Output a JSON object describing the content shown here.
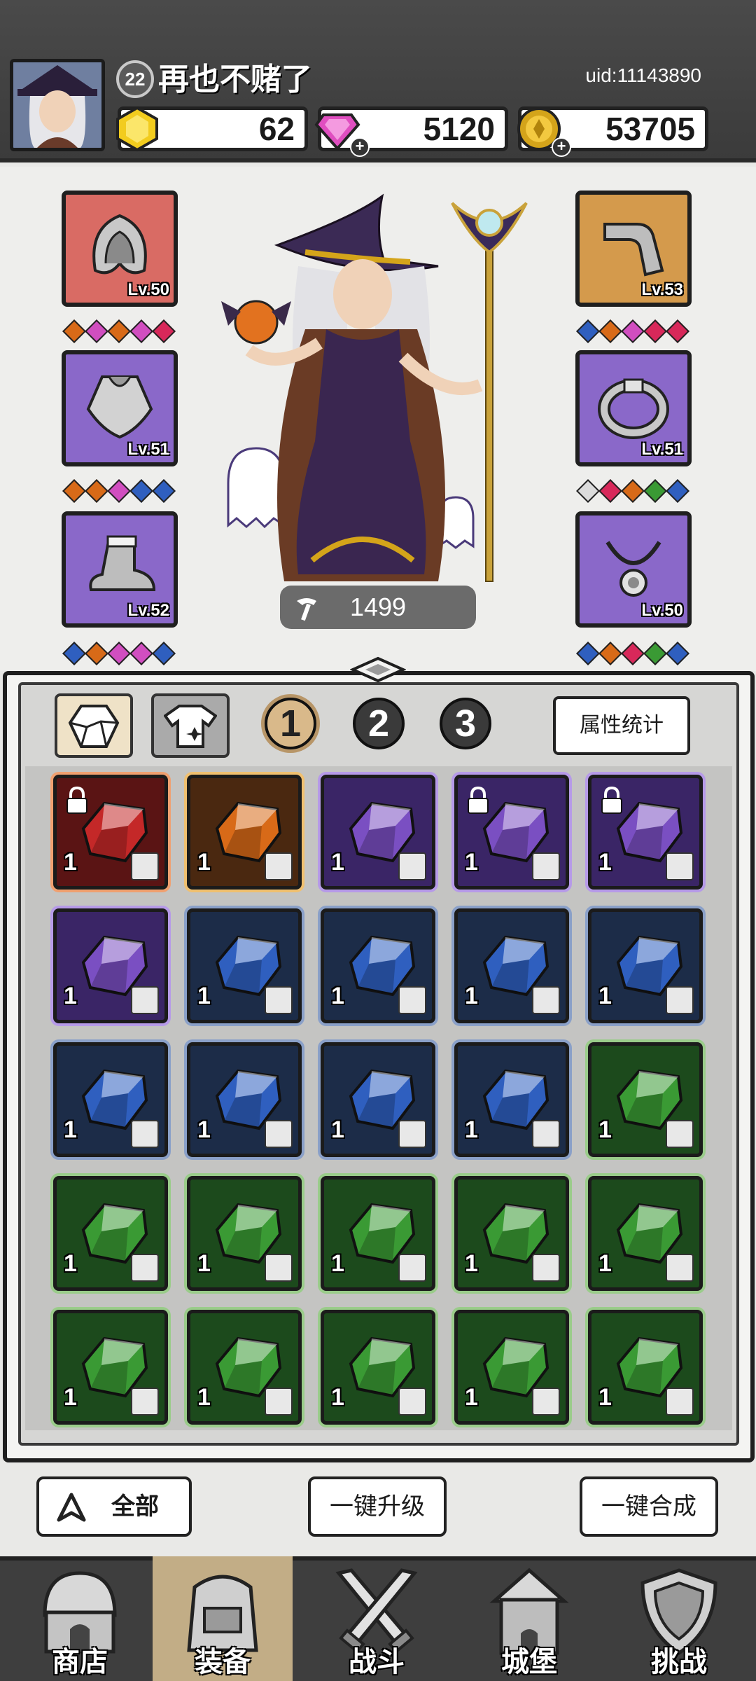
{
  "player": {
    "level": "22",
    "name": "再也不赌了",
    "uid": "uid:11143890"
  },
  "currencies": [
    {
      "icon": "yellow-gem-icon",
      "value": "62",
      "has_plus": false
    },
    {
      "icon": "pink-diamond-icon",
      "value": "5120",
      "has_plus": true
    },
    {
      "icon": "gold-coin-icon",
      "value": "53705",
      "has_plus": true
    }
  ],
  "equipment": {
    "left": [
      {
        "slot": "helmet",
        "icon": "hood-icon",
        "level": "Lv.50",
        "rarity": "red"
      },
      {
        "slot": "armor",
        "icon": "cloak-icon",
        "level": "Lv.51",
        "rarity": "purple"
      },
      {
        "slot": "boots",
        "icon": "boot-icon",
        "level": "Lv.52",
        "rarity": "purple"
      }
    ],
    "right": [
      {
        "slot": "weapon",
        "icon": "bone-icon",
        "level": "Lv.53",
        "rarity": "orange"
      },
      {
        "slot": "ring",
        "icon": "ring-icon",
        "level": "Lv.51",
        "rarity": "purple"
      },
      {
        "slot": "necklace",
        "icon": "necklace-icon",
        "level": "Lv.50",
        "rarity": "purple"
      }
    ]
  },
  "power": "1499",
  "inventory": {
    "pages": [
      "1",
      "2",
      "3"
    ],
    "active_page": "1",
    "stats_button": "属性统计",
    "items": [
      {
        "rarity": "red",
        "count": "1",
        "locked": true
      },
      {
        "rarity": "orange",
        "count": "1",
        "locked": false
      },
      {
        "rarity": "purple",
        "count": "1",
        "locked": false
      },
      {
        "rarity": "purple",
        "count": "1",
        "locked": true
      },
      {
        "rarity": "purple",
        "count": "1",
        "locked": true
      },
      {
        "rarity": "purple",
        "count": "1",
        "locked": false
      },
      {
        "rarity": "blue",
        "count": "1",
        "locked": false
      },
      {
        "rarity": "blue",
        "count": "1",
        "locked": false
      },
      {
        "rarity": "blue",
        "count": "1",
        "locked": false
      },
      {
        "rarity": "blue",
        "count": "1",
        "locked": false
      },
      {
        "rarity": "blue",
        "count": "1",
        "locked": false
      },
      {
        "rarity": "blue",
        "count": "1",
        "locked": false
      },
      {
        "rarity": "blue",
        "count": "1",
        "locked": false
      },
      {
        "rarity": "blue",
        "count": "1",
        "locked": false
      },
      {
        "rarity": "green",
        "count": "1",
        "locked": false
      },
      {
        "rarity": "green",
        "count": "1",
        "locked": false
      },
      {
        "rarity": "green",
        "count": "1",
        "locked": false
      },
      {
        "rarity": "green",
        "count": "1",
        "locked": false
      },
      {
        "rarity": "green",
        "count": "1",
        "locked": false
      },
      {
        "rarity": "green",
        "count": "1",
        "locked": false
      },
      {
        "rarity": "green",
        "count": "1",
        "locked": false
      },
      {
        "rarity": "green",
        "count": "1",
        "locked": false
      },
      {
        "rarity": "green",
        "count": "1",
        "locked": false
      },
      {
        "rarity": "green",
        "count": "1",
        "locked": false
      },
      {
        "rarity": "green",
        "count": "1",
        "locked": false
      }
    ]
  },
  "actions": {
    "filter": "全部",
    "upgrade": "一键升级",
    "merge": "一键合成"
  },
  "nav": [
    {
      "label": "商店",
      "icon": "shop-icon"
    },
    {
      "label": "装备",
      "icon": "backpack-icon",
      "active": true
    },
    {
      "label": "战斗",
      "icon": "crossed-swords-icon"
    },
    {
      "label": "城堡",
      "icon": "castle-icon"
    },
    {
      "label": "挑战",
      "icon": "shield-icon"
    }
  ],
  "colors": {
    "red": "#c42828",
    "orange": "#d86a18",
    "purple": "#7a4fc2",
    "blue": "#2f5fbf",
    "green": "#3a9a34"
  }
}
